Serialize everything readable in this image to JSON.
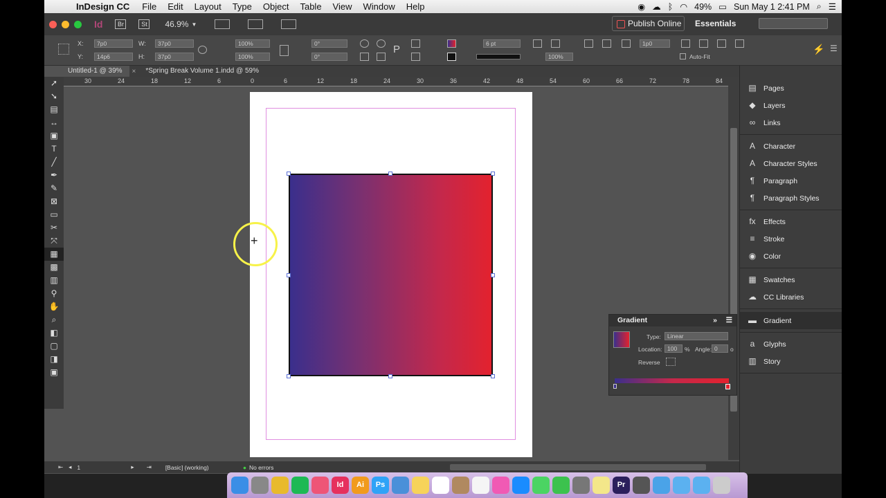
{
  "menubar": {
    "app_name": "InDesign CC",
    "items": [
      "File",
      "Edit",
      "Layout",
      "Type",
      "Object",
      "Table",
      "View",
      "Window",
      "Help"
    ],
    "battery": "49%",
    "datetime": "Sun May 1  2:41 PM"
  },
  "appbar": {
    "logo": "Id",
    "bridge_label": "Br",
    "stock_label": "St",
    "zoom": "46.9%",
    "publish_label": "Publish Online",
    "workspace": "Essentials"
  },
  "control": {
    "x_label": "X:",
    "x_value": "7p0",
    "y_label": "Y:",
    "y_value": "14p6",
    "w_label": "W:",
    "w_value": "37p0",
    "h_label": "H:",
    "h_value": "37p0",
    "scale_x": "100%",
    "scale_y": "100%",
    "rotate": "0°",
    "shear": "0°",
    "stroke_weight": "6 pt",
    "opacity": "100%",
    "frame_value": "1p0",
    "autofit_label": "Auto-Fit"
  },
  "tabs": [
    {
      "label": "Untitled-1 @ 39%",
      "active": true
    },
    {
      "label": "*Spring Break Volume 1.indd @ 59%",
      "active": false
    }
  ],
  "ruler_h": [
    "30",
    "24",
    "18",
    "12",
    "6",
    "0",
    "6",
    "12",
    "18",
    "24",
    "30",
    "36",
    "42",
    "48",
    "54",
    "60",
    "66",
    "72",
    "78",
    "84"
  ],
  "status": {
    "page": "1",
    "style": "[Basic] (working)",
    "errors": "No errors"
  },
  "panels": [
    {
      "group": [
        {
          "label": "Pages",
          "icon": "pages-icon"
        },
        {
          "label": "Layers",
          "icon": "layers-icon"
        },
        {
          "label": "Links",
          "icon": "links-icon"
        }
      ]
    },
    {
      "group": [
        {
          "label": "Character",
          "icon": "character-icon"
        },
        {
          "label": "Character Styles",
          "icon": "character-styles-icon"
        },
        {
          "label": "Paragraph",
          "icon": "paragraph-icon"
        },
        {
          "label": "Paragraph Styles",
          "icon": "paragraph-styles-icon"
        }
      ]
    },
    {
      "group": [
        {
          "label": "Effects",
          "icon": "effects-icon"
        },
        {
          "label": "Stroke",
          "icon": "stroke-icon"
        },
        {
          "label": "Color",
          "icon": "color-icon"
        }
      ]
    },
    {
      "group": [
        {
          "label": "Swatches",
          "icon": "swatches-icon"
        },
        {
          "label": "CC Libraries",
          "icon": "cc-libraries-icon"
        }
      ]
    },
    {
      "group": [
        {
          "label": "Gradient",
          "icon": "gradient-icon",
          "active": true
        }
      ]
    },
    {
      "group": [
        {
          "label": "Glyphs",
          "icon": "glyphs-icon"
        },
        {
          "label": "Story",
          "icon": "story-icon"
        }
      ]
    }
  ],
  "gradient_panel": {
    "title": "Gradient",
    "type_label": "Type:",
    "type_value": "Linear",
    "location_label": "Location:",
    "location_value": "100",
    "percent": "%",
    "angle_label": "Angle:",
    "angle_value": "0",
    "degree": "o",
    "reverse_label": "Reverse",
    "start_color": "#3a2f8c",
    "end_color": "#e3222e"
  },
  "dock_apps": [
    "Finder",
    "Launchpad",
    "Chrome",
    "Spotify",
    "Photos",
    "InDesign",
    "Illustrator",
    "Photoshop",
    "Preview",
    "Notes",
    "Calendar",
    "Contacts",
    "Reminders",
    "iTunes",
    "App Store",
    "Messages",
    "FaceTime",
    "System Preferences",
    "Stickies",
    "Premiere",
    "QuickTime",
    "Folder",
    "Documents",
    "Downloads",
    "Trash"
  ]
}
